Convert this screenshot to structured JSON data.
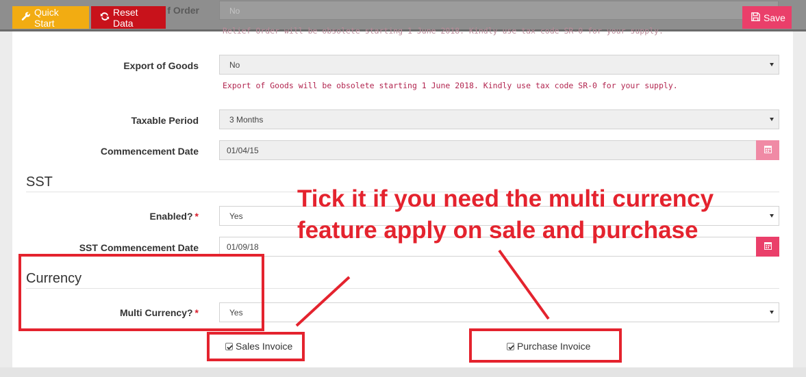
{
  "toolbar": {
    "quick_start_label": "Quick Start",
    "reset_data_label": "Reset Data",
    "save_label": "Save",
    "ghost_label": "f Order",
    "ghost_value": "No",
    "ghost_note": "Relief Order will be obsolete starting 1 June 2018. Kindly use tax code SR-0 for your supply."
  },
  "form": {
    "export_of_goods": {
      "label": "Export of Goods",
      "value": "No",
      "note": "Export of Goods will be obsolete starting 1 June 2018. Kindly use tax code SR-0 for your supply."
    },
    "taxable_period": {
      "label": "Taxable Period",
      "value": "3 Months"
    },
    "commencement_date": {
      "label": "Commencement Date",
      "value": "01/04/15"
    }
  },
  "sst": {
    "title": "SST",
    "enabled": {
      "label": "Enabled?",
      "required_mark": "*",
      "value": "Yes"
    },
    "commencement_date": {
      "label": "SST Commencement Date",
      "value": "01/09/18"
    }
  },
  "currency": {
    "title": "Currency",
    "multi_currency": {
      "label": "Multi Currency?",
      "required_mark": "*",
      "value": "Yes"
    },
    "sales_invoice": {
      "label": "Sales Invoice",
      "checked": true
    },
    "purchase_invoice": {
      "label": "Purchase Invoice",
      "checked": true
    }
  },
  "annotation": {
    "text": "Tick it if you need the multi currency feature apply on sale and purchase"
  },
  "colors": {
    "quick_start": "#f2ac12",
    "reset_data": "#c8121b",
    "save": "#ea3f6a",
    "calendar_button": "#ea3f6a",
    "annotation": "#e4232e",
    "obsolete_note": "#b2254f"
  },
  "icons": {
    "quick_start": "wrench-icon",
    "reset_data": "refresh-icon",
    "save": "floppy-disk-icon",
    "calendar": "calendar-icon",
    "select_caret": "caret-down-icon",
    "checkbox": "check-icon"
  }
}
